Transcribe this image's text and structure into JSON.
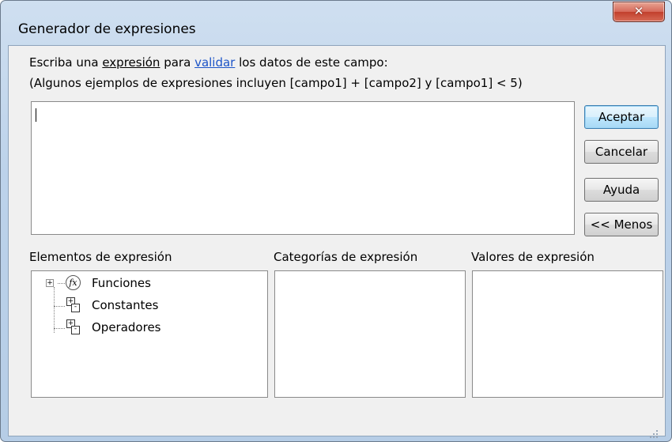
{
  "window": {
    "title": "Generador de expresiones"
  },
  "instructions": {
    "line1_prefix": "Escriba una ",
    "line1_expresion": "expresión",
    "line1_mid": " para ",
    "line1_link": "validar",
    "line1_suffix": " los datos de este campo:",
    "line2": "(Algunos ejemplos de expresiones incluyen [campo1] + [campo2] y [campo1] < 5)"
  },
  "expression_box": {
    "value": ""
  },
  "buttons": {
    "accept": "Aceptar",
    "cancel": "Cancelar",
    "help": "Ayuda",
    "less": "<< Menos"
  },
  "panels": {
    "elements": {
      "label": "Elementos de expresión",
      "items": [
        {
          "label": "Funciones",
          "icon": "function-icon",
          "expander": "+"
        },
        {
          "label": "Constantes",
          "icon": "constants-icon"
        },
        {
          "label": "Operadores",
          "icon": "operators-icon"
        }
      ]
    },
    "categories": {
      "label": "Categorías de expresión"
    },
    "values": {
      "label": "Valores de expresión"
    }
  },
  "colors": {
    "accent_link": "#1c54c8",
    "close_button": "#c2402d"
  }
}
